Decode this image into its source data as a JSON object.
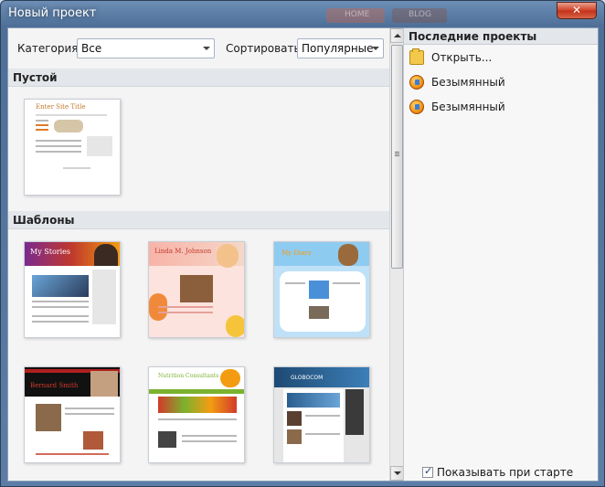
{
  "window": {
    "title": "Новый проект",
    "close_label": "✕",
    "behind_tabs": [
      "HOME",
      "BLOG"
    ]
  },
  "filters": {
    "category_label": "Категория:",
    "category_value": "Все",
    "sort_label": "Сортировать:",
    "sort_value": "Популярные"
  },
  "sections": {
    "empty": "Пустой",
    "templates": "Шаблоны"
  },
  "thumbnails": {
    "empty_site_title": "Enter Site Title",
    "templates": [
      {
        "title": "My Stories",
        "accent": "#6a2a7a"
      },
      {
        "title": "Linda M. Johnson",
        "accent": "#e65b4b"
      },
      {
        "title": "My Diary",
        "accent": "#3b8fd8"
      },
      {
        "title": "Bernard Smith",
        "accent": "#b02020"
      },
      {
        "title": "Nutrition Consultants",
        "accent": "#7bb22e"
      },
      {
        "title": "GLOBOCOM",
        "accent": "#2a5e8e"
      }
    ]
  },
  "recent": {
    "header": "Последние проекты",
    "items": [
      {
        "label": "Открыть...",
        "icon": "open-folder-icon"
      },
      {
        "label": "Безымянный",
        "icon": "project-icon"
      },
      {
        "label": "Безымянный",
        "icon": "project-icon"
      }
    ]
  },
  "startup": {
    "label": "Показывать при старте",
    "checked": true
  },
  "colors": {
    "title_bar": "#4d6f98",
    "close_button": "#d2492f",
    "section_bg": "#e3e6ea"
  }
}
